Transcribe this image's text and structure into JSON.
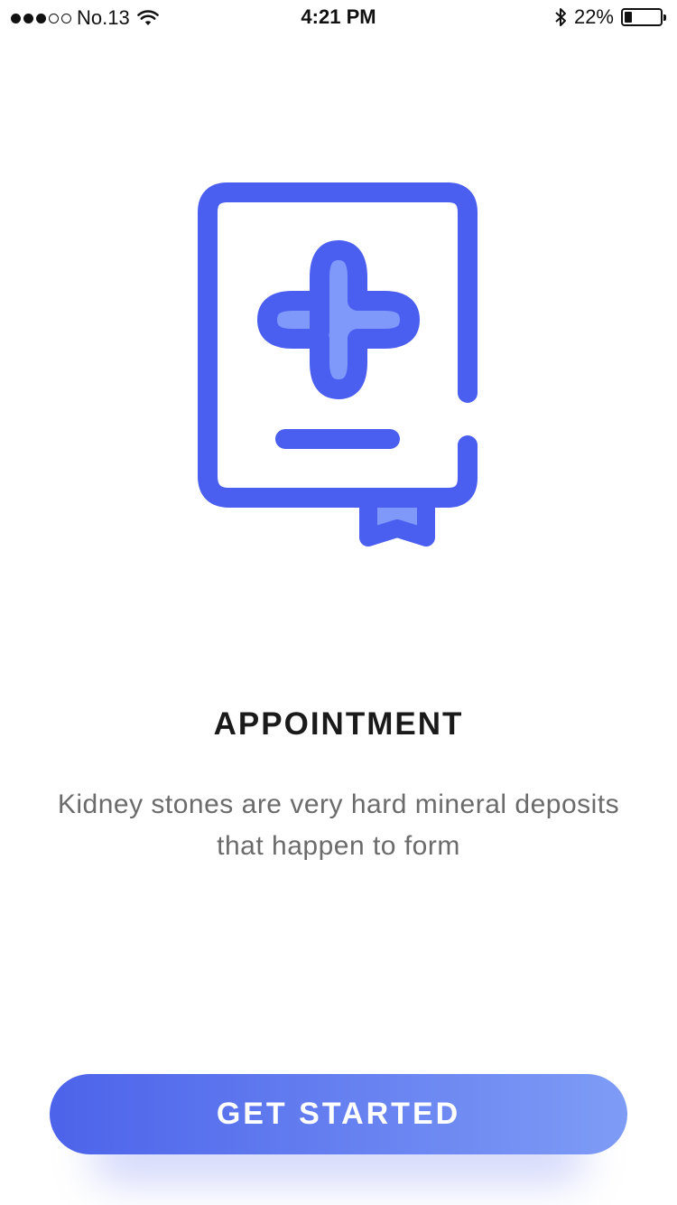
{
  "status_bar": {
    "carrier": "No.13",
    "time": "4:21 PM",
    "battery_text": "22%",
    "battery_level": 0.22
  },
  "illustration": {
    "icon": "medical-book-icon",
    "stroke_color": "#4a5ef0",
    "fill_color": "#7f99fb"
  },
  "content": {
    "title": "APPOINTMENT",
    "description": "Kidney stones are very hard mineral deposits that happen to form"
  },
  "button": {
    "label": "GET STARTED",
    "gradient_start": "#4c63ea",
    "gradient_end": "#7e9cf6"
  }
}
